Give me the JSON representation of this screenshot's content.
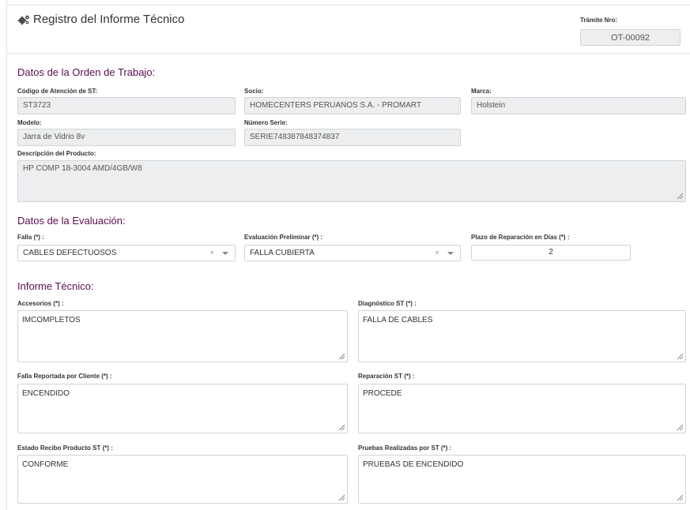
{
  "header": {
    "title": "Registro del Informe Técnico",
    "tramite_label": "Trámite Nro:",
    "tramite_value": "OT-00092"
  },
  "orden": {
    "section_title": "Datos de la Orden de Trabajo:",
    "codigo_label": "Código de Atención de ST:",
    "codigo_value": "ST3723",
    "socio_label": "Socio:",
    "socio_value": "HOMECENTERS PERUANOS S.A. - PROMART",
    "marca_label": "Marca:",
    "marca_value": "Holstein",
    "modelo_label": "Modelo:",
    "modelo_value": "Jarra de Vidrio 8v",
    "serie_label": "Número Serie:",
    "serie_value": "SERIE748387848374837",
    "descripcion_label": "Descripción del Producto:",
    "descripcion_value": "HP COMP 18-3004 AMD/4GB/W8"
  },
  "evaluacion": {
    "section_title": "Datos de la Evaluación:",
    "falla_label": "Falla (*) :",
    "falla_value": "CABLES DEFECTUOSOS",
    "eval_label": "Evaluación Preliminar (*) :",
    "eval_value": "FALLA CUBIERTA",
    "plazo_label": "Plazo de Reparación en Días (*) :",
    "plazo_value": "2",
    "clear_glyph": "×"
  },
  "informe": {
    "section_title": "Informe Técnico:",
    "accesorios_label": "Accesorios (*) :",
    "accesorios_value": "IMCOMPLETOS",
    "diagnostico_label": "Diagnóstico ST (*) :",
    "diagnostico_value": "FALLA DE CABLES",
    "falla_cliente_label": "Falla Reportada por Cliente (*) :",
    "falla_cliente_value": "ENCENDIDO",
    "reparacion_label": "Reparación ST (*) :",
    "reparacion_value": "PROCEDE",
    "estado_label": "Estado Recibo Producto ST (*) :",
    "estado_value": "CONFORME",
    "pruebas_label": "Pruebas Realizadas por ST (*) :",
    "pruebas_value": "PRUEBAS DE ENCENDIDO"
  },
  "colors": {
    "section_title": "#5a0c4f",
    "readonly_bg": "#eceeef",
    "border": "#cfd4d9"
  },
  "icons": {
    "title_icon": "gears-icon",
    "select_arrow": "chevron-down-icon",
    "resize": "resize-grip-icon"
  }
}
